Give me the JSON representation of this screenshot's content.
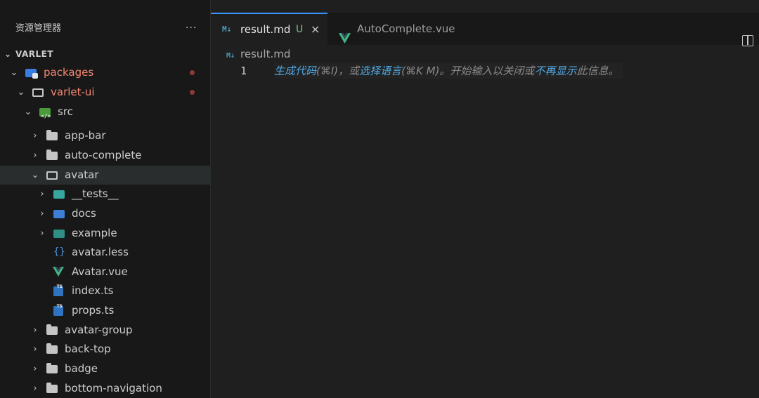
{
  "sidebar": {
    "title": "资源管理器",
    "more": "···",
    "section": "VARLET",
    "items": [
      {
        "label": "packages"
      },
      {
        "label": "varlet-ui"
      },
      {
        "label": "src"
      },
      {
        "label": "app-bar"
      },
      {
        "label": "auto-complete"
      },
      {
        "label": "avatar"
      },
      {
        "label": "__tests__"
      },
      {
        "label": "docs"
      },
      {
        "label": "example"
      },
      {
        "label": "avatar.less"
      },
      {
        "label": "Avatar.vue"
      },
      {
        "label": "index.ts"
      },
      {
        "label": "props.ts"
      },
      {
        "label": "avatar-group"
      },
      {
        "label": "back-top"
      },
      {
        "label": "badge"
      },
      {
        "label": "bottom-navigation"
      }
    ]
  },
  "tabs": [
    {
      "icon": "M↓",
      "label": "result.md",
      "badge": "U",
      "close": "×"
    },
    {
      "label": "AutoComplete.vue"
    }
  ],
  "breadcrumb": {
    "icon": "M↓",
    "label": "result.md"
  },
  "editor": {
    "line_number": "1",
    "hint": {
      "p1": "生成代码",
      "p2": "(⌘I)，或",
      "p3": "选择语言",
      "p4": "(⌘K M)。开始输入以关闭或",
      "p5": "不再显示",
      "p6": "此信息。"
    }
  },
  "colors": {
    "accent": "#3794ff",
    "untracked_file": "#f48771",
    "untracked_badge": "#73c991",
    "vue_green": "#41b883",
    "hint_link": "#4fa9e6"
  }
}
